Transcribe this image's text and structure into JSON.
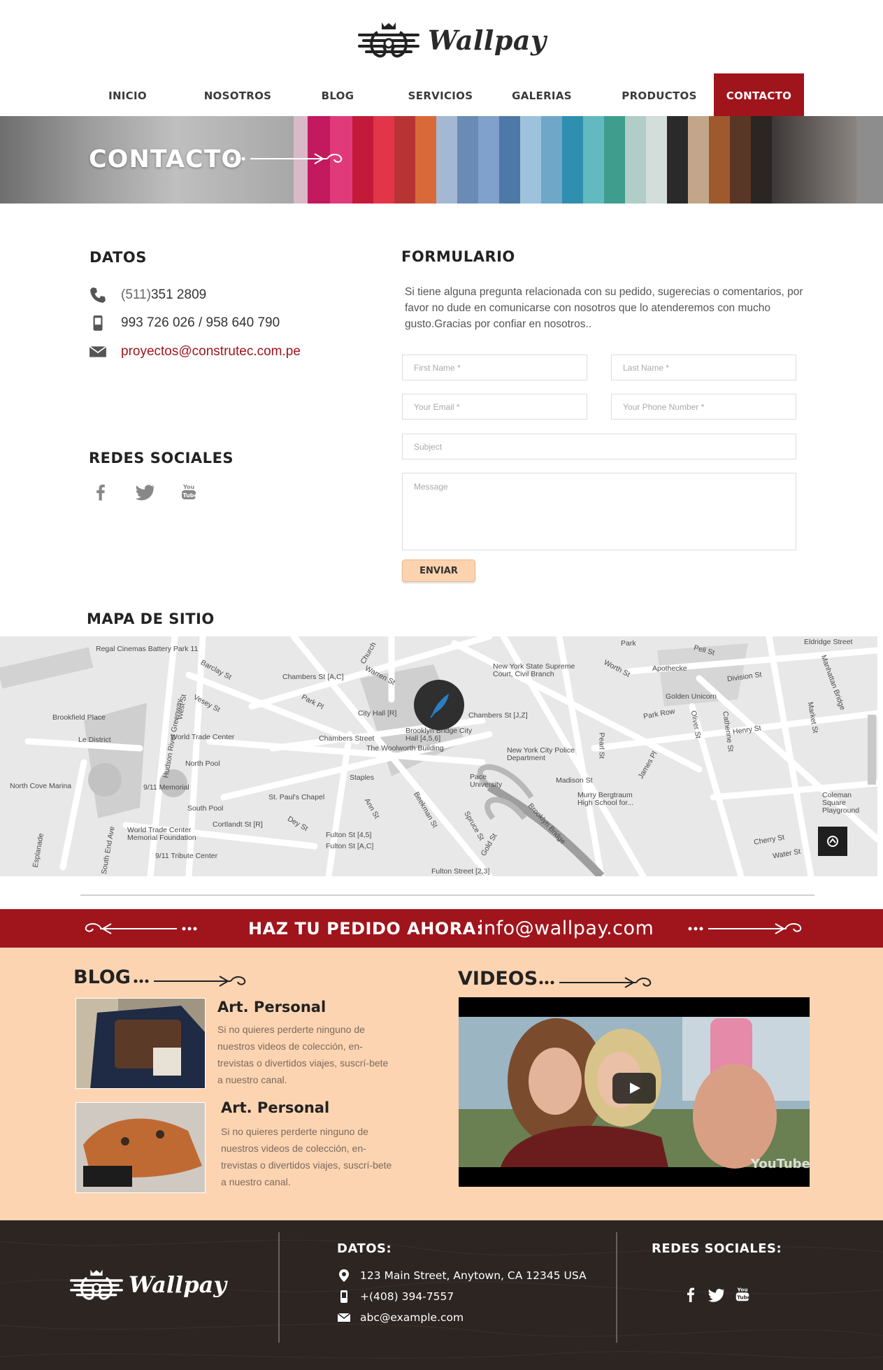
{
  "brand": {
    "name": "Wallpay"
  },
  "nav": {
    "items": [
      {
        "label": "INICIO"
      },
      {
        "label": "NOSOTROS"
      },
      {
        "label": "BLOG"
      },
      {
        "label": "SERVICIOS"
      },
      {
        "label": "GALERIAS"
      },
      {
        "label": "PRODUCTOS"
      },
      {
        "label": "CONTACTO",
        "active": true
      }
    ]
  },
  "hero": {
    "title": "CONTACTO"
  },
  "datos": {
    "title": "DATOS",
    "phone_prefix": "(511)",
    "phone": " 351 2809",
    "mobile": "993 726 026 / 958 640 790",
    "email": "proyectos@construtec.com.pe"
  },
  "social": {
    "title": "REDES SOCIALES",
    "icons": [
      "facebook-icon",
      "twitter-icon",
      "youtube-icon"
    ]
  },
  "form": {
    "title": "FORMULARIO",
    "intro": "Si tiene alguna pregunta relacionada con su pedido, sugerecias o comentarios, por favor no dude en comunicarse con nosotros que lo atenderemos con mucho gusto.Gracias por confiar en nosotros..",
    "first_name": "First Name *",
    "last_name": "Last Name *",
    "email": "Your Email *",
    "phone": "Your Phone Number *",
    "subject": "Subject",
    "message": "Message",
    "submit": "ENVIAR"
  },
  "map": {
    "title": "MAPA DE SITIO",
    "labels": [
      "Regal Cinemas Battery Park 11",
      "Barclay St",
      "Chambers St [A,C]",
      "Warren St",
      "Church",
      "New York State Supreme Court, Civil Branch",
      "Worth St",
      "Park",
      "Pell St",
      "Apothecke",
      "Division St",
      "Golden Unicorn",
      "Eldridge Street",
      "Brookfield Place",
      "Vesey St",
      "West St",
      "Park Pl",
      "City Hall [R]",
      "Chambers St [J,Z]",
      "Park Row",
      "Oliver St",
      "Henry St",
      "Le District",
      "World Trade Center",
      "Chambers Street",
      "The Woolworth Building",
      "Brooklyn Bridge City Hall [4,5,6]",
      "New York City Police Department",
      "Pearl St",
      "Madison St",
      "North Pool",
      "North Cove Marina",
      "9/11 Memorial",
      "Staples",
      "Pace University",
      "Murry Bergtraum High School for...",
      "St. Paul's Chapel",
      "South Pool",
      "Ann St",
      "Beekman St",
      "Spruce St",
      "Brooklyn Bridge",
      "Coleman Square Playground",
      "Cortlandt St [R]",
      "Dey St",
      "Fulton St [4,5]",
      "Fulton St [A,C]",
      "World Trade Center Memorial Foundation",
      "9/11 Tribute Center",
      "Gold St",
      "Cherry St",
      "Water St",
      "Market St",
      "Catherine St",
      "Manhattan Bridge",
      "Fulton Street [2,3]",
      "Esplanade",
      "South End Ave",
      "James Pl",
      "Hudson River Greenway"
    ]
  },
  "order": {
    "label": "HAZ TU PEDIDO AHORA:",
    "email": "info@wallpay.com"
  },
  "blog": {
    "title": "BLOG",
    "posts": [
      {
        "title": "Art. Personal",
        "text": "Si no quieres perderte ninguno de nuestros videos de colección, en-trevistas o divertidos viajes, suscrí-bete a nuestro canal."
      },
      {
        "title": "Art. Personal",
        "text": "Si no quieres perderte ninguno de nuestros videos de colección, en-trevistas o divertidos viajes, suscrí-bete a nuestro canal."
      }
    ]
  },
  "videos": {
    "title": "VIDEOS",
    "watermark": "YouTube"
  },
  "footer": {
    "datos_title": "DATOS:",
    "address": "123 Main Street, Anytown, CA 12345 USA",
    "phone": "+(408) 394-7557",
    "email": "abc@example.com",
    "social_title": "REDES SOCIALES:"
  },
  "colors": {
    "accent": "#a0141c",
    "peach": "#fdd4b1",
    "footer": "#2d2522"
  }
}
